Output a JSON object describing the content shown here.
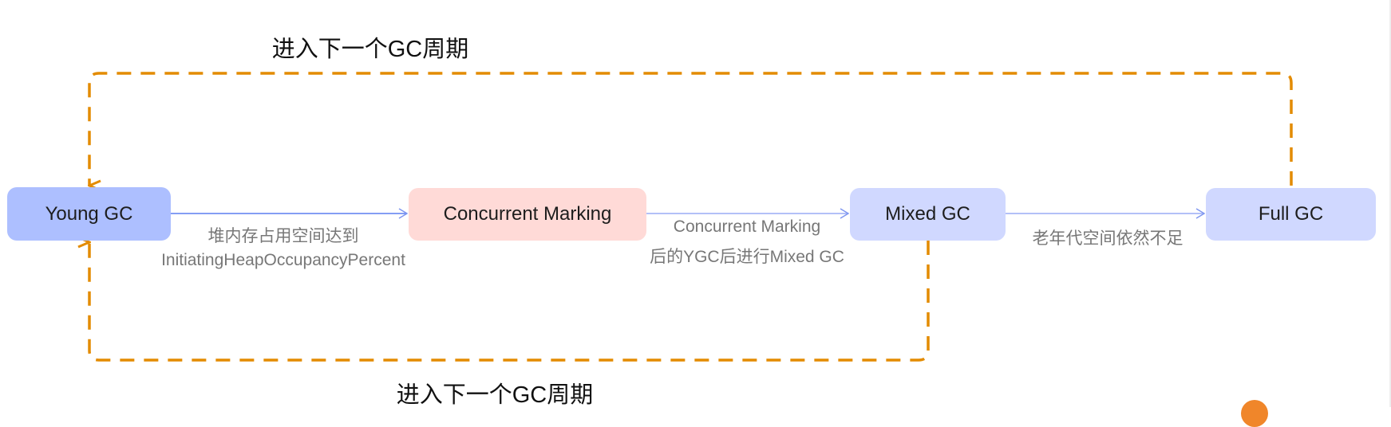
{
  "colors": {
    "young_gc": "#adbfff",
    "concurrent_marking": "#ffdad7",
    "mixed_gc": "#d0d8ff",
    "full_gc": "#d0d8ff",
    "loop_dash": "#e38b00",
    "arrow": "#7f96f0"
  },
  "nodes": {
    "young_gc": "Young GC",
    "concurrent_marking": "Concurrent Marking",
    "mixed_gc": "Mixed GC",
    "full_gc": "Full GC"
  },
  "edges": {
    "young_to_cm": [
      "堆内存占用空间达到",
      "InitiatingHeapOccupancyPercent"
    ],
    "cm_to_mixed": [
      "Concurrent Marking",
      "后的YGC后进行Mixed GC"
    ],
    "mixed_to_full": [
      "老年代空间依然不足"
    ]
  },
  "loops": {
    "top_label": "进入下一个GC周期",
    "bottom_label": "进入下一个GC周期"
  }
}
